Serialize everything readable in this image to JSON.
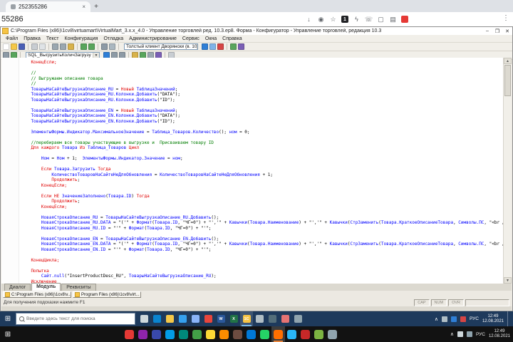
{
  "browser": {
    "tab_title": "252355286",
    "tab_close_glyph": "×",
    "new_tab_glyph": "+",
    "address": "55286",
    "menu_glyph": "⋮",
    "ext_icons": [
      {
        "name": "download-icon",
        "glyph": "↓"
      },
      {
        "name": "reader-mode-icon",
        "glyph": "◉"
      },
      {
        "name": "bookmark-star-icon",
        "glyph": "☆"
      },
      {
        "name": "extension-counter-badge",
        "text": "1",
        "bg": "#202124",
        "fg": "#ffffff"
      },
      {
        "name": "lightning-extension-icon",
        "glyph": "ϟ"
      },
      {
        "name": "phone-extension-icon",
        "glyph": "☏"
      },
      {
        "name": "cast-screen-icon",
        "glyph": "▢"
      },
      {
        "name": "print-extension-icon",
        "glyph": "▤"
      },
      {
        "name": "adblock-extension-icon",
        "bg": "#e53935"
      }
    ]
  },
  "window": {
    "title": "C:\\Program Files (x86)\\1cv8\\virtuamart\\VirtualMart_3.x.x_4.0 - Управление торговлей ред. 10.3.ер8. Форма - Конфигуратор - Управление торговлей, редакция 10.3",
    "min_glyph": "–",
    "max_glyph": "❐",
    "close_glyph": "✕"
  },
  "menu": {
    "items": [
      "Файл",
      "Правка",
      "Текст",
      "Конфигурация",
      "Отладка",
      "Администрирование",
      "Сервис",
      "Окна",
      "Справка"
    ]
  },
  "toolbars": {
    "tb1": [
      {
        "k": "icon",
        "n": "new-file-icon",
        "c": "#ffffff"
      },
      {
        "k": "icon",
        "n": "open-folder-icon",
        "c": "#f5c848"
      },
      {
        "k": "icon",
        "n": "save-icon",
        "c": "#4a5fb5"
      },
      {
        "k": "sep"
      },
      {
        "k": "icon",
        "n": "print-icon",
        "c": "#c8cdd2"
      },
      {
        "k": "icon",
        "n": "print-preview-icon",
        "c": "#dfe3e6"
      },
      {
        "k": "sep"
      },
      {
        "k": "icon",
        "n": "cut-icon",
        "c": "#9aa7b0"
      },
      {
        "k": "icon",
        "n": "copy-icon",
        "c": "#9aa7b0"
      },
      {
        "k": "icon",
        "n": "paste-icon",
        "c": "#d8b24a"
      },
      {
        "k": "sep"
      },
      {
        "k": "icon",
        "n": "undo-icon",
        "c": "#58a55c"
      },
      {
        "k": "icon",
        "n": "redo-icon",
        "c": "#58a55c"
      },
      {
        "k": "sep"
      },
      {
        "k": "icon",
        "n": "find-icon",
        "c": "#8d9aa5"
      },
      {
        "k": "icon",
        "n": "replace-icon",
        "c": "#aab7c0"
      },
      {
        "k": "sep"
      },
      {
        "k": "combo",
        "n": "debug-client-combo",
        "text": "Толстый клиент Дворянски (в. 10",
        "w": 104
      },
      {
        "k": "icon",
        "n": "start-debug-icon",
        "c": "#2f7fd6"
      },
      {
        "k": "icon",
        "n": "step-debug-icon",
        "c": "#7fb3e8"
      },
      {
        "k": "icon",
        "n": "stop-debug-icon",
        "c": "#d64545"
      },
      {
        "k": "sep"
      },
      {
        "k": "icon",
        "n": "syntax-check-icon",
        "c": "#58a55c"
      },
      {
        "k": "icon",
        "n": "help-icon",
        "c": "#7a5fb5"
      }
    ],
    "tb2": [
      {
        "k": "icon",
        "n": "procedures-list-icon",
        "c": "#8d9aa5"
      },
      {
        "k": "icon",
        "n": "module-check-icon",
        "c": "#58a55c"
      },
      {
        "k": "sep"
      },
      {
        "k": "combo",
        "n": "procedure-combo",
        "text": "SQL_ВыгрузитьКоличЗагрузу",
        "w": 104
      },
      {
        "k": "icon",
        "n": "goto-definition-icon",
        "c": "#2f7fd6"
      },
      {
        "k": "icon",
        "n": "back-icon",
        "c": "#8d9aa5"
      },
      {
        "k": "icon",
        "n": "forward-icon",
        "c": "#8d9aa5"
      },
      {
        "k": "sep"
      },
      {
        "k": "icon",
        "n": "bookmark-icon",
        "c": "#d8b24a"
      },
      {
        "k": "icon",
        "n": "comment-block-icon",
        "c": "#58a55c"
      },
      {
        "k": "icon",
        "n": "uncomment-block-icon",
        "c": "#9aa7b0"
      },
      {
        "k": "icon",
        "n": "format-block-icon",
        "c": "#7a5fb5"
      },
      {
        "k": "sep"
      },
      {
        "k": "icon",
        "n": "syntax-help-icon",
        "c": "#c8cdd2"
      }
    ]
  },
  "editor": {
    "lines": [
      [
        [
          "k",
          "    КонецЕсли;"
        ]
      ],
      [
        [
          "p",
          ""
        ]
      ],
      [
        [
          "c",
          "    //"
        ]
      ],
      [
        [
          "c",
          "    // Выгружаем описание товара"
        ]
      ],
      [
        [
          "c",
          "    //"
        ]
      ],
      [
        [
          "i",
          "    ТоварыНаСайтеВыгрузкаОписание_RU"
        ],
        [
          "p",
          " = "
        ],
        [
          "k",
          "Новый"
        ],
        [
          "i",
          " ТаблицаЗначений"
        ],
        [
          "p",
          ";"
        ]
      ],
      [
        [
          "i",
          "    ТоварыНаСайтеВыгрузкаОписание_RU.Колонки.Добавить"
        ],
        [
          "p",
          "("
        ],
        [
          "s",
          "\"DATA\""
        ],
        [
          "p",
          ");"
        ]
      ],
      [
        [
          "i",
          "    ТоварыНаСайтеВыгрузкаОписание_RU.Колонки.Добавить"
        ],
        [
          "p",
          "("
        ],
        [
          "s",
          "\"ID\""
        ],
        [
          "p",
          ");"
        ]
      ],
      [
        [
          "p",
          ""
        ]
      ],
      [
        [
          "i",
          "    ТоварыНаСайтеВыгрузкаОписание_EN"
        ],
        [
          "p",
          " = "
        ],
        [
          "k",
          "Новый"
        ],
        [
          "i",
          " ТаблицаЗначений"
        ],
        [
          "p",
          ";"
        ]
      ],
      [
        [
          "i",
          "    ТоварыНаСайтеВыгрузкаОписание_EN.Колонки.Добавить"
        ],
        [
          "p",
          "("
        ],
        [
          "s",
          "\"DATA\""
        ],
        [
          "p",
          ");"
        ]
      ],
      [
        [
          "i",
          "    ТоварыНаСайтеВыгрузкаОписание_EN.Колонки.Добавить"
        ],
        [
          "p",
          "("
        ],
        [
          "s",
          "\"ID\""
        ],
        [
          "p",
          ");"
        ]
      ],
      [
        [
          "p",
          ""
        ]
      ],
      [
        [
          "i",
          "    ЭлементыФормы.Индикатор.МаксимальноеЗначение"
        ],
        [
          "p",
          " = "
        ],
        [
          "i",
          "Таблица_Товаров.Количество"
        ],
        [
          "p",
          "(); "
        ],
        [
          "i",
          "ном"
        ],
        [
          "p",
          " = 0;"
        ]
      ],
      [
        [
          "p",
          ""
        ]
      ],
      [
        [
          "c",
          "    //перебираем все товары участвующие в выгрузке и  Присваиваем товару ID"
        ]
      ],
      [
        [
          "k",
          "    Для"
        ],
        [
          "p",
          " "
        ],
        [
          "k",
          "каждого"
        ],
        [
          "p",
          " "
        ],
        [
          "i",
          "Товара"
        ],
        [
          "p",
          " "
        ],
        [
          "k",
          "Из"
        ],
        [
          "p",
          " "
        ],
        [
          "i",
          "Таблица_Товаров"
        ],
        [
          "p",
          " "
        ],
        [
          "k",
          "Цикл"
        ]
      ],
      [
        [
          "p",
          ""
        ]
      ],
      [
        [
          "i",
          "        Ном"
        ],
        [
          "p",
          " = "
        ],
        [
          "i",
          "Ном"
        ],
        [
          "p",
          " + 1;  "
        ],
        [
          "i",
          "ЭлементыФормы.Индикатор.Значение"
        ],
        [
          "p",
          " = "
        ],
        [
          "i",
          "ном"
        ],
        [
          "p",
          ";"
        ]
      ],
      [
        [
          "p",
          ""
        ]
      ],
      [
        [
          "k",
          "        Если"
        ],
        [
          "p",
          " "
        ],
        [
          "i",
          "Товара.Загрузить"
        ],
        [
          "p",
          " "
        ],
        [
          "k",
          "Тогда"
        ]
      ],
      [
        [
          "i",
          "            КоличествоТоваровНаСайтеНеДляОбновления"
        ],
        [
          "p",
          " = "
        ],
        [
          "i",
          "КоличествоТоваровНаСайтеНеДляОбновления"
        ],
        [
          "p",
          " + 1;"
        ]
      ],
      [
        [
          "k",
          "            Продолжить"
        ],
        [
          "p",
          ";"
        ]
      ],
      [
        [
          "k",
          "        КонецЕсли;"
        ]
      ],
      [
        [
          "p",
          ""
        ]
      ],
      [
        [
          "k",
          "        Если"
        ],
        [
          "p",
          " "
        ],
        [
          "k",
          "НЕ"
        ],
        [
          "p",
          " "
        ],
        [
          "i",
          "ЗначениеЗаполнено"
        ],
        [
          "p",
          "("
        ],
        [
          "i",
          "Товара.ID"
        ],
        [
          "p",
          ") "
        ],
        [
          "k",
          "Тогда"
        ]
      ],
      [
        [
          "k",
          "            Продолжить"
        ],
        [
          "p",
          ";"
        ]
      ],
      [
        [
          "k",
          "        КонецЕсли;"
        ]
      ],
      [
        [
          "p",
          ""
        ]
      ],
      [
        [
          "i",
          "        НоваяСтрокаОписание_RU"
        ],
        [
          "p",
          " = "
        ],
        [
          "i",
          "ТоварыНаСайтеВыгрузкаОписание_RU.Добавить"
        ],
        [
          "p",
          "();"
        ]
      ],
      [
        [
          "i",
          "        НоваяСтрокаОписание_RU.DATA"
        ],
        [
          "p",
          " = "
        ],
        [
          "s",
          "\"('\""
        ],
        [
          "p",
          " + "
        ],
        [
          "i",
          "Формат"
        ],
        [
          "p",
          "("
        ],
        [
          "i",
          "Товара.ID"
        ],
        [
          "p",
          ", "
        ],
        [
          "s",
          "\"ЧГ=0\""
        ],
        [
          "p",
          ") + "
        ],
        [
          "s",
          "\"','\""
        ],
        [
          "p",
          " + "
        ],
        [
          "i",
          "Кавычки"
        ],
        [
          "p",
          "("
        ],
        [
          "i",
          "Товара.Наименование"
        ],
        [
          "p",
          ") + "
        ],
        [
          "s",
          "\"','\""
        ],
        [
          "p",
          " + "
        ],
        [
          "i",
          "Кавычки"
        ],
        [
          "p",
          "("
        ],
        [
          "i",
          "СтрЗаменить"
        ],
        [
          "p",
          "("
        ],
        [
          "i",
          "Товара.КраткоеОписаниеТовара"
        ],
        [
          "p",
          ", "
        ],
        [
          "i",
          "Символы.ПС"
        ],
        [
          "p",
          ", "
        ],
        [
          "s",
          "\"<br />\""
        ],
        [
          "p",
          ")) + "
        ],
        [
          "s",
          "\"')\""
        ],
        [
          "p",
          ";"
        ]
      ],
      [
        [
          "i",
          "        НоваяСтрокаОписание_RU.ID"
        ],
        [
          "p",
          " = "
        ],
        [
          "s",
          "\"'\""
        ],
        [
          "p",
          " + "
        ],
        [
          "i",
          "Формат"
        ],
        [
          "p",
          "("
        ],
        [
          "i",
          "Товара.ID"
        ],
        [
          "p",
          ", "
        ],
        [
          "s",
          "\"ЧГ=0\""
        ],
        [
          "p",
          ") + "
        ],
        [
          "s",
          "\"'\""
        ],
        [
          "p",
          ";"
        ]
      ],
      [
        [
          "p",
          ""
        ]
      ],
      [
        [
          "i",
          "        НоваяСтрокаОписание_EN"
        ],
        [
          "p",
          " = "
        ],
        [
          "i",
          "ТоварыНаСайтеВыгрузкаОписание_EN.Добавить"
        ],
        [
          "p",
          "();"
        ]
      ],
      [
        [
          "i",
          "        НоваяСтрокаОписание_EN.DATA"
        ],
        [
          "p",
          " = "
        ],
        [
          "s",
          "\"('\""
        ],
        [
          "p",
          " + "
        ],
        [
          "i",
          "Формат"
        ],
        [
          "p",
          "("
        ],
        [
          "i",
          "Товара.ID"
        ],
        [
          "p",
          ", "
        ],
        [
          "s",
          "\"ЧГ=0\""
        ],
        [
          "p",
          ") + "
        ],
        [
          "s",
          "\"','\""
        ],
        [
          "p",
          " + "
        ],
        [
          "i",
          "Кавычки"
        ],
        [
          "p",
          "("
        ],
        [
          "i",
          "Товара.Наименование"
        ],
        [
          "p",
          ") + "
        ],
        [
          "s",
          "\"','\""
        ],
        [
          "p",
          " + "
        ],
        [
          "i",
          "Кавычки"
        ],
        [
          "p",
          "("
        ],
        [
          "i",
          "СтрЗаменить"
        ],
        [
          "p",
          "("
        ],
        [
          "i",
          "Товара.КраткоеОписаниеТовара"
        ],
        [
          "p",
          ", "
        ],
        [
          "i",
          "Символы.ПС"
        ],
        [
          "p",
          ", "
        ],
        [
          "s",
          "\"<br />\""
        ],
        [
          "p",
          ")) + "
        ],
        [
          "s",
          "\"')\""
        ],
        [
          "p",
          ";"
        ]
      ],
      [
        [
          "i",
          "        НоваяСтрокаОписание_EN.ID"
        ],
        [
          "p",
          " = "
        ],
        [
          "s",
          "\"'\""
        ],
        [
          "p",
          " + "
        ],
        [
          "i",
          "Формат"
        ],
        [
          "p",
          "("
        ],
        [
          "i",
          "Товара.ID"
        ],
        [
          "p",
          ", "
        ],
        [
          "s",
          "\"ЧГ=0\""
        ],
        [
          "p",
          ") + "
        ],
        [
          "s",
          "\"'\""
        ],
        [
          "p",
          ";"
        ]
      ],
      [
        [
          "p",
          ""
        ]
      ],
      [
        [
          "k",
          "    КонецЦикла;"
        ]
      ],
      [
        [
          "p",
          ""
        ]
      ],
      [
        [
          "k",
          "    Попытка"
        ]
      ],
      [
        [
          "i",
          "        Сайт.null"
        ],
        [
          "p",
          "("
        ],
        [
          "s",
          "\"InsertProductDesc_RU\""
        ],
        [
          "p",
          ", "
        ],
        [
          "i",
          "ТоварыНаСайтеВыгрузкаОписание_RU"
        ],
        [
          "p",
          ");"
        ]
      ],
      [
        [
          "k",
          "    Исключение"
        ]
      ]
    ]
  },
  "doc_tabs": {
    "items": [
      "Диалог",
      "Модуль",
      "Реквизиты"
    ],
    "active": 1
  },
  "mdi_tabs": [
    {
      "label": "C:\\Program Files (x86)\\1cv8\\v..."
    },
    {
      "label": "Program Files (x86)\\1cv8\\virt..."
    }
  ],
  "status": {
    "hint": "Для получения подсказки нажмите F1",
    "cells": [
      "CAP",
      "NUM",
      "OVR"
    ]
  },
  "taskbar": {
    "search_placeholder": "Введите здесь текст для поиска",
    "icons": [
      {
        "n": "task-view-icon",
        "c": "#cfd8dc"
      },
      {
        "n": "edge-icon",
        "c": "#0a84d0"
      },
      {
        "n": "explorer-icon",
        "c": "#f5c848"
      },
      {
        "n": "store-icon",
        "c": "#35a0ee"
      },
      {
        "n": "mail-icon",
        "c": "#8ab4f8"
      },
      {
        "n": "chrome-icon",
        "c": "#e8453c"
      },
      {
        "n": "word-icon",
        "c": "#2b579a",
        "t": "W"
      },
      {
        "n": "excel-icon",
        "c": "#217346",
        "t": "X"
      },
      {
        "n": "1c-app-icon",
        "c": "#f6c445",
        "t": "1С",
        "active": true
      },
      {
        "n": "notepad-icon",
        "c": "#b0bec5"
      },
      {
        "n": "calculator-icon",
        "c": "#546e7a"
      },
      {
        "n": "paint-icon",
        "c": "#e57373"
      },
      {
        "n": "settings-icon",
        "c": "#90a4ae"
      }
    ],
    "tray": {
      "chevron": "∧",
      "lang": "РУС",
      "time": "12:49",
      "date": "12.08.2021"
    }
  },
  "local_taskbar": {
    "icons": [
      {
        "n": "app-icon-1",
        "c": "#e53935"
      },
      {
        "n": "app-icon-2",
        "c": "#8e24aa"
      },
      {
        "n": "app-icon-3",
        "c": "#3949ab"
      },
      {
        "n": "app-icon-4",
        "c": "#039be5"
      },
      {
        "n": "app-icon-5",
        "c": "#00897b"
      },
      {
        "n": "app-icon-6",
        "c": "#43a047"
      },
      {
        "n": "app-icon-7",
        "c": "#fdd835"
      },
      {
        "n": "app-icon-8",
        "c": "#fb8c00"
      },
      {
        "n": "app-icon-9",
        "c": "#6d4c41"
      },
      {
        "n": "app-icon-10",
        "c": "#0078d7"
      },
      {
        "n": "app-icon-11",
        "c": "#25d366"
      },
      {
        "n": "browser-active-icon",
        "c": "#ff6f00",
        "active": true
      },
      {
        "n": "app-icon-13",
        "c": "#29b6f6"
      },
      {
        "n": "app-icon-14",
        "c": "#c62828"
      },
      {
        "n": "app-icon-15",
        "c": "#7cb342"
      },
      {
        "n": "app-icon-16",
        "c": "#90a4ae"
      }
    ],
    "tray": {
      "chevron": "∧",
      "lang": "РУС",
      "time": "12:49",
      "date": "12.08.2021"
    }
  }
}
